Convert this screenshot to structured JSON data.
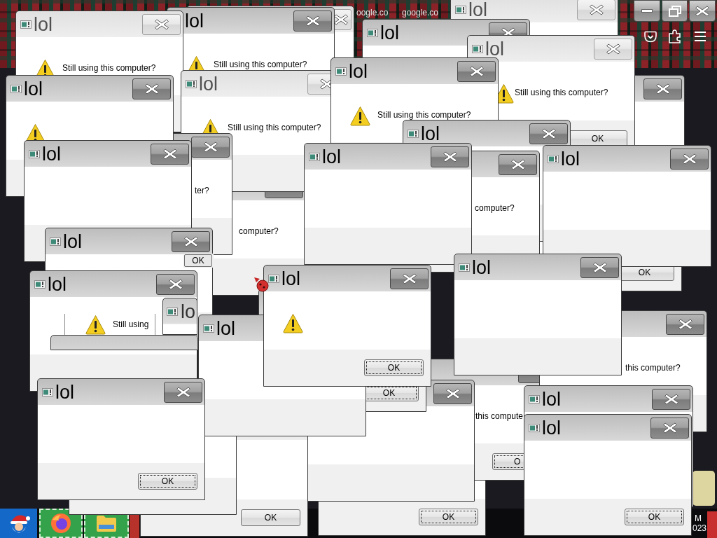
{
  "browser": {
    "tabs": [
      {
        "title": "oogle.co"
      },
      {
        "title": "google.co"
      }
    ]
  },
  "windows": [
    {
      "kind": "dialog",
      "title": "lol",
      "active": false,
      "warning": true,
      "message": "Still using this computer?"
    },
    {
      "kind": "dialog",
      "title": "lol",
      "active": true,
      "warning": true,
      "message": "Still using this computer?"
    },
    {
      "kind": "dialog",
      "active": false
    },
    {
      "kind": "dialog",
      "title": "lol",
      "active": true
    },
    {
      "kind": "dialog",
      "title": "lol",
      "active": false
    },
    {
      "kind": "dialog",
      "title": "lol",
      "active": true,
      "warning": true
    },
    {
      "kind": "dialog",
      "title": "lol",
      "active": false,
      "warning": true,
      "message": "Still using this computer?"
    },
    {
      "kind": "dialog",
      "title": "lol",
      "active": true,
      "warning": true,
      "message": "Still using this computer?"
    },
    {
      "kind": "dialog",
      "title": "lol",
      "active": false,
      "warning": true,
      "message": "Still using this computer?",
      "ok_button": "OK"
    },
    {
      "kind": "dialog",
      "active": true
    },
    {
      "kind": "dialog",
      "title": "lol",
      "active": true
    },
    {
      "kind": "dialog",
      "active": true,
      "message": "ter?"
    },
    {
      "kind": "dialog",
      "active": true,
      "message": "computer?"
    },
    {
      "kind": "dialog",
      "title": "lol",
      "active": true
    },
    {
      "kind": "dialog",
      "active": true,
      "message": "computer?"
    },
    {
      "kind": "dialog",
      "title": "lol",
      "active": true
    },
    {
      "kind": "dialog",
      "active": false,
      "ok_button": "OK"
    },
    {
      "kind": "dialog",
      "title": "lol",
      "active": true
    },
    {
      "kind": "dialog",
      "title": "lol",
      "active": true
    },
    {
      "kind": "dialog",
      "title": "lol",
      "active": true
    },
    {
      "kind": "fragment",
      "ok_button": "OK"
    },
    {
      "kind": "dialog",
      "title": "lol",
      "active": true,
      "warning": true,
      "ok_button": "OK"
    },
    {
      "kind": "dialog",
      "title": "lol",
      "active": true
    },
    {
      "kind": "fragment",
      "warning": true,
      "message": "Still using"
    },
    {
      "kind": "fragment",
      "title": "lo"
    },
    {
      "kind": "dialog",
      "title": "lol",
      "active": true
    },
    {
      "kind": "dialog",
      "active": true,
      "ok_button": "OK"
    },
    {
      "kind": "dialog",
      "active": true,
      "message": "this computer?"
    },
    {
      "kind": "fragment"
    },
    {
      "kind": "dialog",
      "title": "lol",
      "active": true,
      "ok_button": "OK"
    },
    {
      "kind": "dialog"
    },
    {
      "kind": "dialog",
      "active": false,
      "ok_button": "OK"
    },
    {
      "kind": "dialog",
      "active": true
    },
    {
      "kind": "dialog",
      "active": true,
      "ok_button": "OK"
    },
    {
      "kind": "dialog",
      "active": true,
      "message": "this compute",
      "ok_button": "O"
    },
    {
      "kind": "dialog",
      "title": "lol",
      "active": true
    },
    {
      "kind": "dialog",
      "title": "lol",
      "active": true,
      "ok_button": "OK"
    }
  ],
  "taskbar": {
    "clock": [
      "M",
      "023"
    ]
  }
}
